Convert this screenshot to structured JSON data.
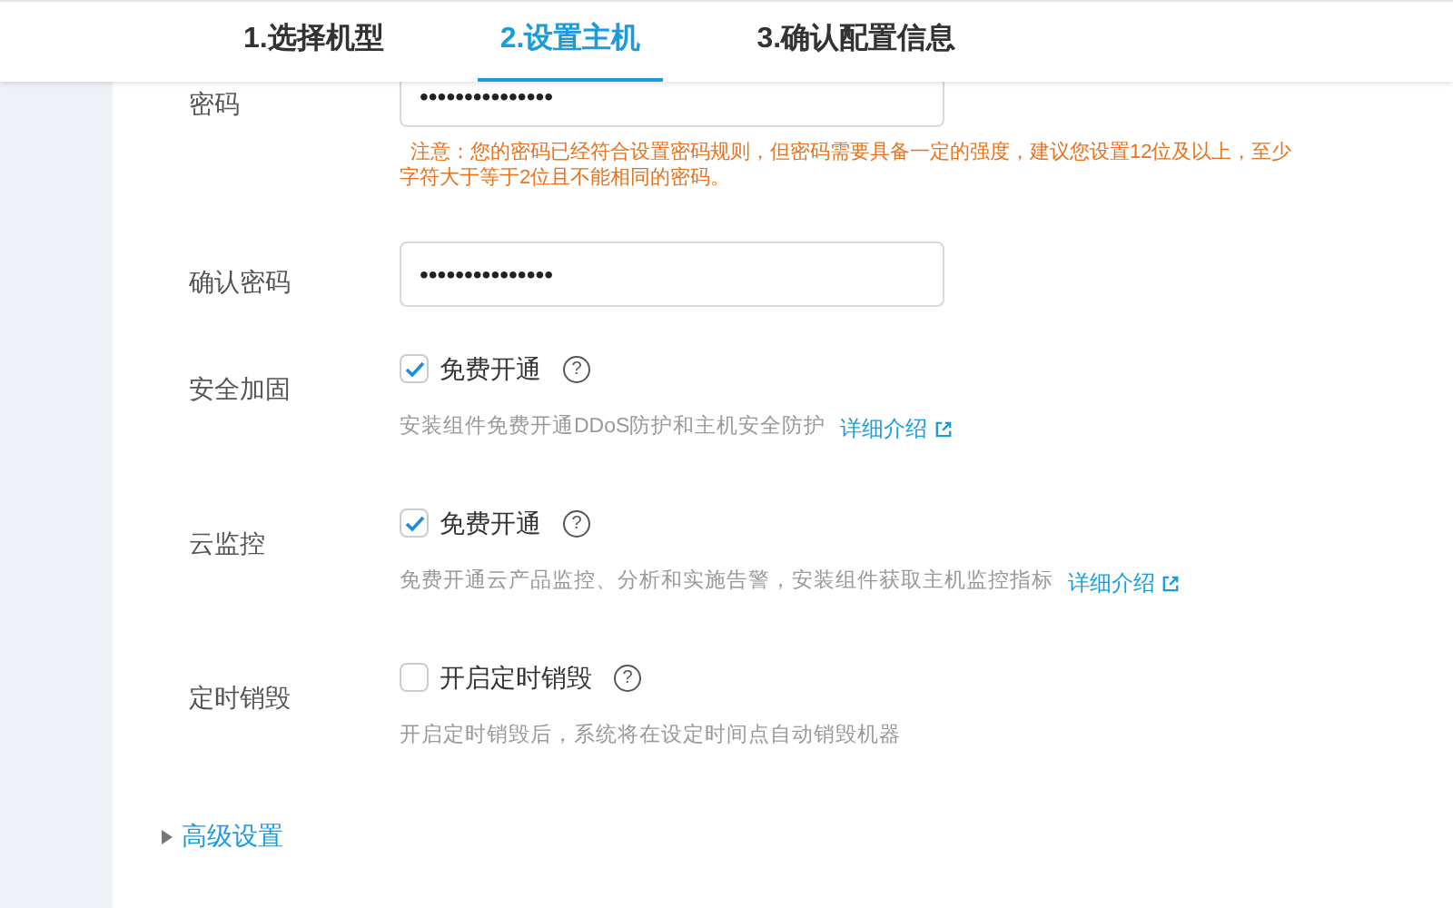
{
  "steps": [
    {
      "label": "1.选择机型",
      "selected": false
    },
    {
      "label": "2.设置主机",
      "selected": true
    },
    {
      "label": "3.确认配置信息",
      "selected": false
    }
  ],
  "password": {
    "label": "密码",
    "value": "•••••••••••••••",
    "warning_lines": [
      "注意：您的密码已经符合设置密码规则，但密码需要具备一定的强度，建议您设置12位及以上，至少",
      "字符大于等于2位且不能相同的密码。"
    ]
  },
  "confirm_password": {
    "label": "确认密码",
    "value": "•••••••••••••••"
  },
  "options": [
    {
      "label": "安全加固",
      "checkbox": "免费开通",
      "checked": true,
      "help": "?",
      "description": "安装组件免费开通DDoS防护和主机安全防护",
      "link": "详细介绍"
    },
    {
      "label": "云监控",
      "checkbox": "免费开通",
      "checked": true,
      "help": "?",
      "description": "免费开通云产品监控、分析和实施告警，安装组件获取主机监控指标",
      "link": "详细介绍"
    },
    {
      "label": "定时销毁",
      "checkbox": "开启定时销毁",
      "checked": false,
      "help": "?",
      "description": "开启定时销毁后，系统将在设定时间点自动销毁机器"
    }
  ],
  "advanced": {
    "label": "高级设置",
    "expanded": false
  }
}
